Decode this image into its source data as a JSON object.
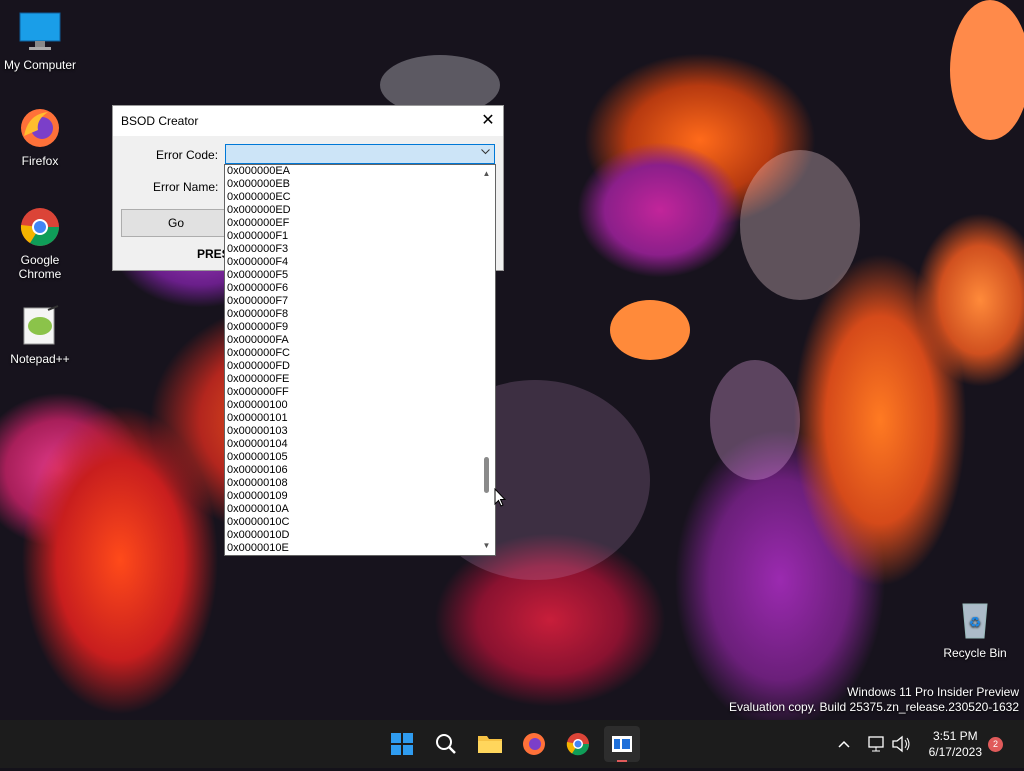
{
  "desktop": {
    "icons": [
      {
        "label": "My Computer"
      },
      {
        "label": "Firefox"
      },
      {
        "label": "Google Chrome"
      },
      {
        "label": "Notepad++"
      },
      {
        "label": "Recycle Bin"
      }
    ],
    "watermark": {
      "line1": "Windows 11 Pro Insider Preview",
      "line2": "Evaluation copy. Build 25375.zn_release.230520-1632"
    }
  },
  "window": {
    "title": "BSOD Creator",
    "close_glyph": "✕",
    "error_code_label": "Error Code:",
    "error_name_label": "Error Name:",
    "go_label": "Go",
    "press_text": "PRES",
    "combo_value": ""
  },
  "dropdown": {
    "items": [
      "0x000000EA",
      "0x000000EB",
      "0x000000EC",
      "0x000000ED",
      "0x000000EF",
      "0x000000F1",
      "0x000000F3",
      "0x000000F4",
      "0x000000F5",
      "0x000000F6",
      "0x000000F7",
      "0x000000F8",
      "0x000000F9",
      "0x000000FA",
      "0x000000FC",
      "0x000000FD",
      "0x000000FE",
      "0x000000FF",
      "0x00000100",
      "0x00000101",
      "0x00000103",
      "0x00000104",
      "0x00000105",
      "0x00000106",
      "0x00000108",
      "0x00000109",
      "0x0000010A",
      "0x0000010C",
      "0x0000010D",
      "0x0000010E"
    ]
  },
  "taskbar": {
    "clock_time": "3:51 PM",
    "clock_date": "6/17/2023",
    "notification_count": "2"
  },
  "colors": {
    "accent": "#0078d7",
    "taskbar": "#1c1c1c"
  }
}
